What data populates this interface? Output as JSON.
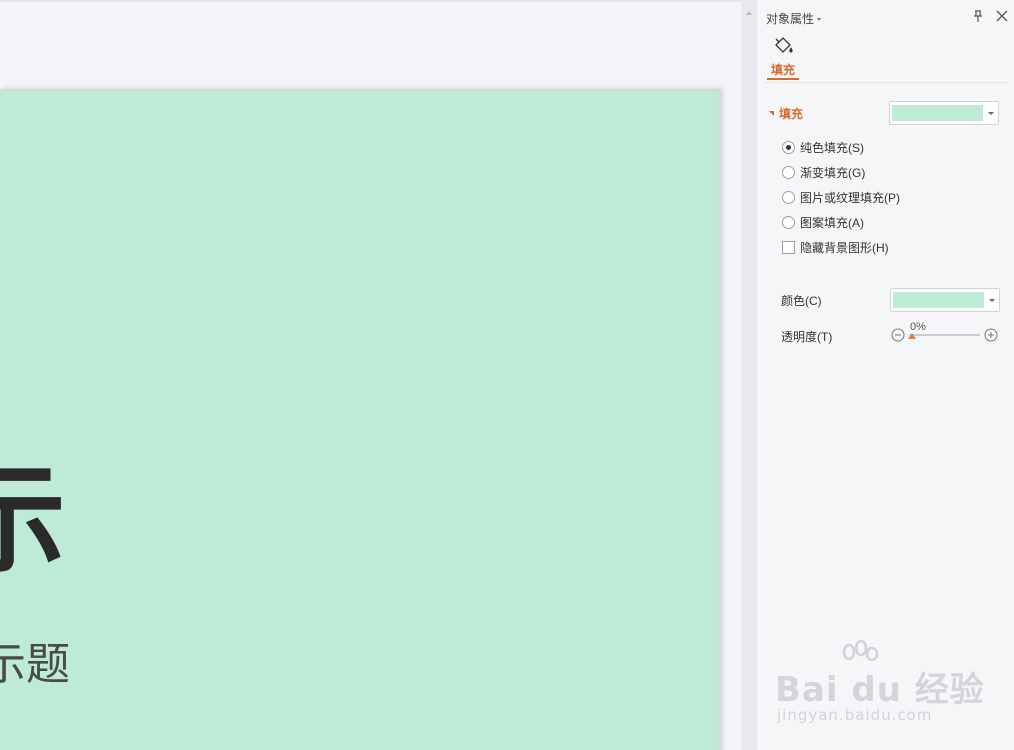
{
  "slide": {
    "title_fragment": "示",
    "subtitle_fragment": "示题",
    "background_color": "#bdebd6"
  },
  "pane": {
    "header": "对象属性",
    "tab_label": "填充",
    "section_label": "填充",
    "options": [
      {
        "label": "纯色填充(S)",
        "type": "radio",
        "checked": true
      },
      {
        "label": "渐变填充(G)",
        "type": "radio",
        "checked": false
      },
      {
        "label": "图片或纹理填充(P)",
        "type": "radio",
        "checked": false
      },
      {
        "label": "图案填充(A)",
        "type": "radio",
        "checked": false
      },
      {
        "label": "隐藏背景图形(H)",
        "type": "checkbox",
        "checked": false
      }
    ],
    "color_label": "颜色(C)",
    "transparency_label": "透明度(T)",
    "transparency_value": "0%",
    "fill_color": "#bdebd6",
    "accent_color": "#d9692f"
  },
  "watermark": {
    "text": "Bai du 经验",
    "url": "jingyan.baidu.com"
  }
}
